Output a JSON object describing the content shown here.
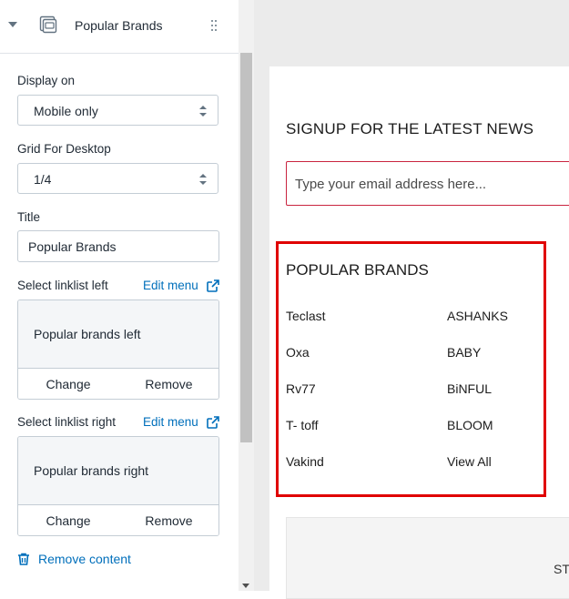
{
  "section": {
    "title": "Popular Brands"
  },
  "fields": {
    "display_on": {
      "label": "Display on",
      "value": "Mobile only"
    },
    "grid_desktop": {
      "label": "Grid For Desktop",
      "value": "1/4"
    },
    "title": {
      "label": "Title",
      "value": "Popular Brands"
    },
    "linklist_left": {
      "label": "Select linklist left",
      "edit": "Edit menu",
      "name": "Popular brands left",
      "change": "Change",
      "remove": "Remove"
    },
    "linklist_right": {
      "label": "Select linklist right",
      "edit": "Edit menu",
      "name": "Popular brands right",
      "change": "Change",
      "remove": "Remove"
    }
  },
  "remove_content": "Remove content",
  "preview": {
    "signup_title": "SIGNUP FOR THE LATEST NEWS",
    "email_placeholder": "Type your email address here...",
    "brands_title": "POPULAR BRANDS",
    "brands_left": [
      "Teclast",
      "Oxa",
      "Rv77",
      "T- toff",
      "Vakind"
    ],
    "brands_right": [
      "ASHANKS",
      "BABY",
      "BiNFUL",
      "BLOOM",
      "View All"
    ],
    "bottom_text": "ST"
  },
  "colors": {
    "link": "#006fbb",
    "highlight_border": "#e00000",
    "email_border": "#c9243f"
  }
}
